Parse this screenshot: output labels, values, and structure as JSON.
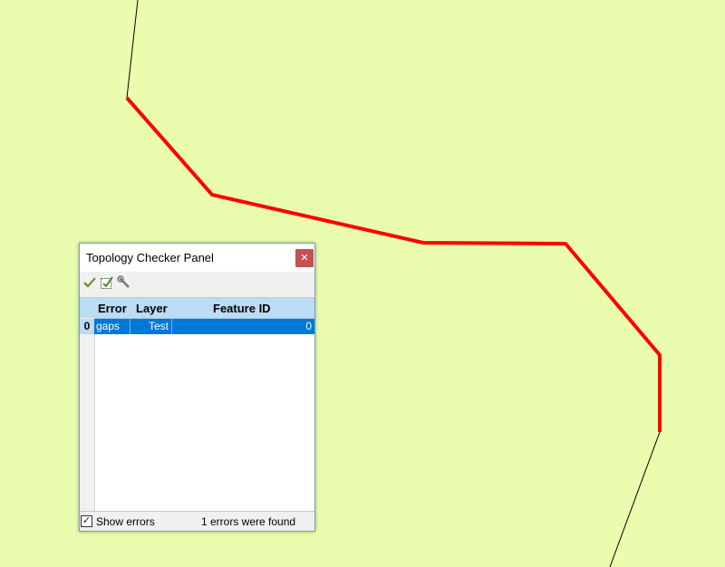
{
  "map": {
    "background": "#eafdae",
    "line_color": "#000000",
    "highlight_color": "#ff0000"
  },
  "panel": {
    "title": "Topology Checker Panel",
    "close_icon": "close-icon",
    "toolbar": [
      {
        "icon": "validate-all-icon"
      },
      {
        "icon": "validate-extent-icon"
      },
      {
        "icon": "configure-rules-icon"
      }
    ],
    "table": {
      "columns": [
        "Error",
        "Layer",
        "Feature ID"
      ],
      "rows": [
        {
          "index": "0",
          "error": "gaps",
          "layer": "Test",
          "feature_id": "0"
        }
      ]
    },
    "status": {
      "show_errors_label": "Show errors",
      "show_errors_checked": true,
      "summary": "1 errors were found"
    }
  }
}
